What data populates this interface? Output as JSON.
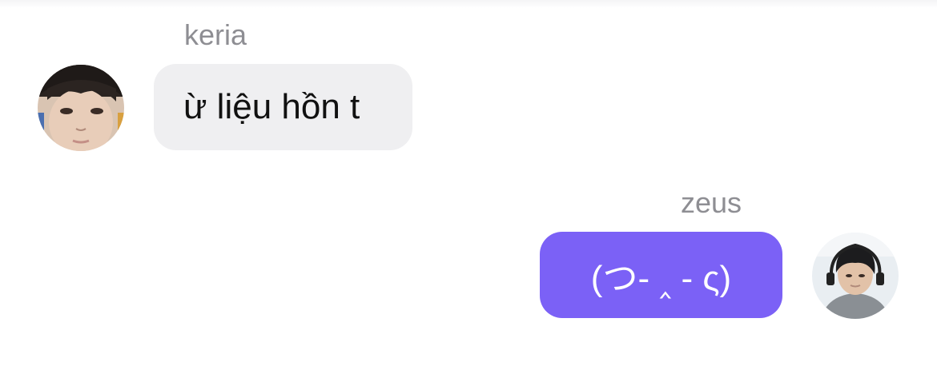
{
  "messages": [
    {
      "sender": "keria",
      "text": "ừ liệu hồn t",
      "direction": "incoming",
      "avatar_icon": "profile-photo-icon"
    },
    {
      "sender": "zeus",
      "text": "(つ- ‸ - ς)",
      "direction": "outgoing",
      "avatar_icon": "profile-photo-icon"
    }
  ],
  "colors": {
    "incoming_bubble": "#efeff1",
    "outgoing_bubble": "#7b61f6",
    "sender_name": "#8e8e93",
    "background": "#ffffff"
  }
}
